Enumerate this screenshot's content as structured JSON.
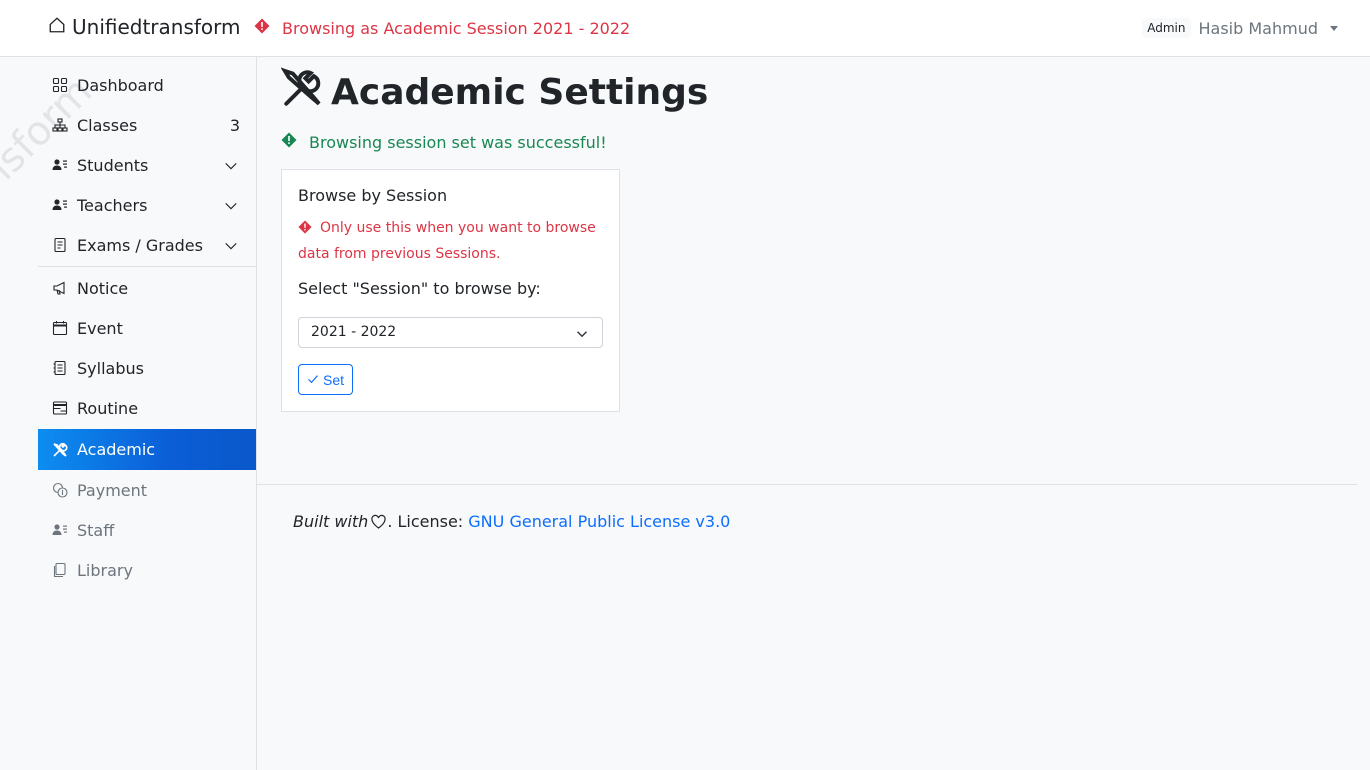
{
  "navbar": {
    "brand": "Unifiedtransform",
    "session_warning": "Browsing as Academic Session 2021 - 2022",
    "role_badge": "Admin",
    "user_name": "Hasib Mahmud"
  },
  "sidebar": {
    "watermark": "nsform",
    "items": [
      {
        "label": "Dashboard",
        "icon": "grid-icon"
      },
      {
        "label": "Classes",
        "icon": "hierarchy-icon",
        "count": "3"
      },
      {
        "label": "Students",
        "icon": "person-lines-icon",
        "expandable": true
      },
      {
        "label": "Teachers",
        "icon": "person-lines-icon",
        "expandable": true
      },
      {
        "label": "Exams / Grades",
        "icon": "journal-icon",
        "expandable": true
      },
      {
        "label": "Notice",
        "icon": "megaphone-icon"
      },
      {
        "label": "Event",
        "icon": "calendar-icon"
      },
      {
        "label": "Syllabus",
        "icon": "journal-text-icon"
      },
      {
        "label": "Routine",
        "icon": "calendar-range-icon"
      },
      {
        "label": "Academic",
        "icon": "tools-icon",
        "active": true
      },
      {
        "label": "Payment",
        "icon": "coins-icon",
        "muted": true
      },
      {
        "label": "Staff",
        "icon": "person-lines-icon",
        "muted": true
      },
      {
        "label": "Library",
        "icon": "journals-icon",
        "muted": true
      }
    ]
  },
  "main": {
    "title": "Academic Settings",
    "success_message": "Browsing session set was successful!",
    "card": {
      "title": "Browse by Session",
      "warning": "Only use this when you want to browse data from previous Sessions.",
      "select_label": "Select \"Session\" to browse by:",
      "select_value": "2021 - 2022",
      "button_label": "Set"
    }
  },
  "footer": {
    "built_with": "Built with",
    "license_prefix": ". License: ",
    "license_link": "GNU General Public License v3.0"
  },
  "colors": {
    "danger": "#dc3545",
    "success": "#198754",
    "primary": "#0d6efd",
    "active_bg": "#0b5ed7"
  }
}
